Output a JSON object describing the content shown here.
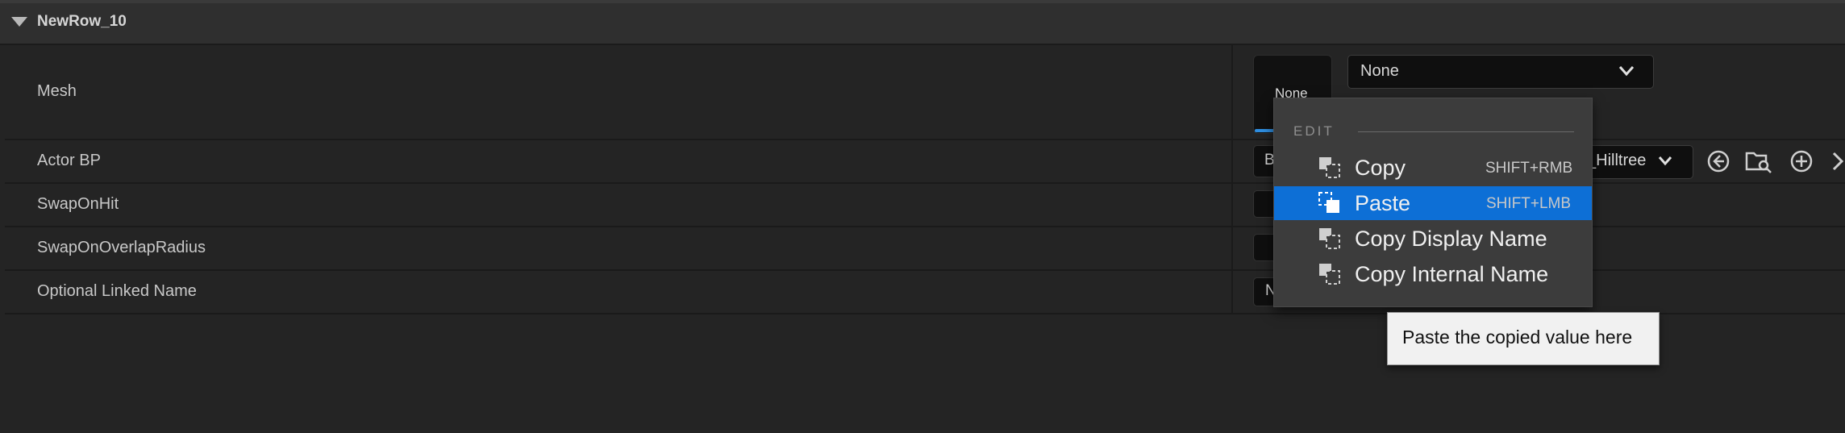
{
  "category": {
    "title": "NewRow_10"
  },
  "rows": [
    {
      "label": "Mesh"
    },
    {
      "label": "Actor BP"
    },
    {
      "label": "SwapOnHit"
    },
    {
      "label": "SwapOnOverlapRadius"
    },
    {
      "label": "Optional Linked Name"
    }
  ],
  "mesh": {
    "thumbnail_text": "None",
    "combo_value": "None"
  },
  "actor_bp": {
    "left_fragment": "B",
    "combo_fragment": "_Hilltree"
  },
  "linked_name": {
    "left_fragment": "N"
  },
  "context_menu": {
    "heading": "EDIT",
    "items": [
      {
        "label": "Copy",
        "shortcut": "SHIFT+RMB",
        "selected": false
      },
      {
        "label": "Paste",
        "shortcut": "SHIFT+LMB",
        "selected": true
      },
      {
        "label": "Copy Display Name",
        "shortcut": "",
        "selected": false
      },
      {
        "label": "Copy Internal Name",
        "shortcut": "",
        "selected": false
      }
    ]
  },
  "tooltip": {
    "text": "Paste the copied value here"
  },
  "colors": {
    "selection": "#0d6fd6",
    "background": "#242424",
    "menu": "#3c3c3c"
  }
}
